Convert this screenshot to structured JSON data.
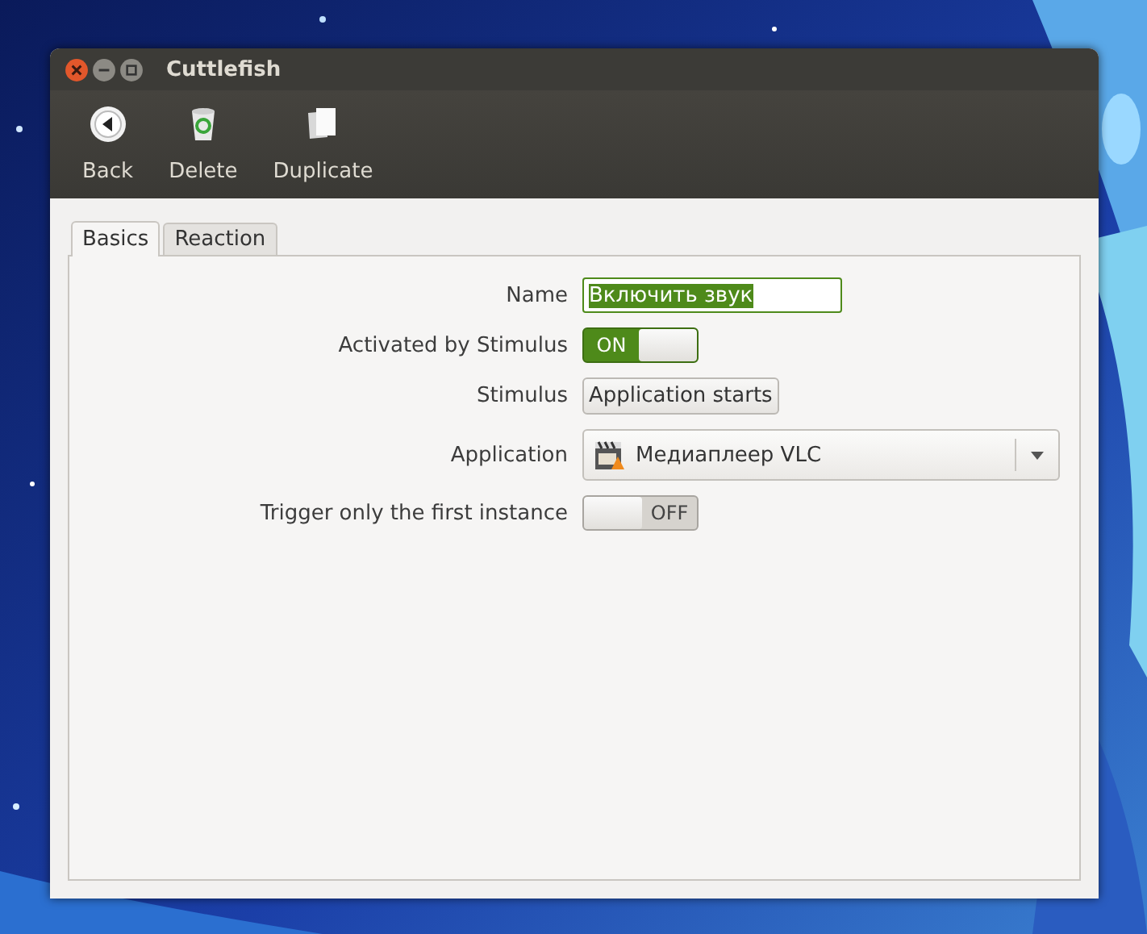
{
  "window": {
    "title": "Cuttlefish"
  },
  "toolbar": [
    {
      "label": "Back",
      "kind": "back"
    },
    {
      "label": "Delete",
      "kind": "delete"
    },
    {
      "label": "Duplicate",
      "kind": "duplicate"
    }
  ],
  "tabs": [
    {
      "label": "Basics",
      "selected": true
    },
    {
      "label": "Reaction",
      "selected": false
    }
  ],
  "form": [
    {
      "label": "Name",
      "kind": "entry",
      "value": "Включить звук"
    },
    {
      "label": "Activated by Stimulus",
      "kind": "switch",
      "on": true,
      "state_text": "ON"
    },
    {
      "label": "Stimulus",
      "kind": "button",
      "value": "Application starts"
    },
    {
      "label": "Application",
      "kind": "combo",
      "value": "Медиаплеер VLC"
    },
    {
      "label": "Trigger only the first instance",
      "kind": "switch",
      "on": false,
      "state_text": "OFF"
    }
  ]
}
